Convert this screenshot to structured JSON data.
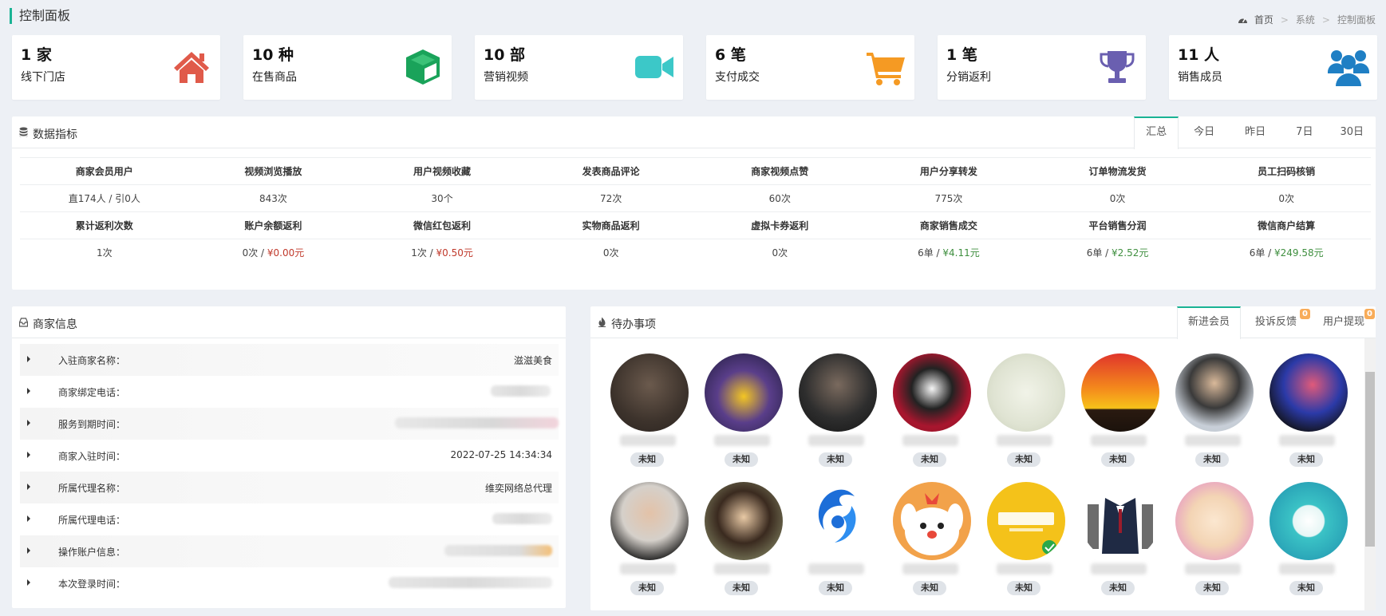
{
  "header": {
    "title": "控制面板",
    "breadcrumb": [
      "首页",
      "系统",
      "控制面板"
    ]
  },
  "stats": [
    {
      "value": "1 家",
      "label": "线下门店",
      "icon": "house-icon",
      "color": "#e05a4a"
    },
    {
      "value": "10 种",
      "label": "在售商品",
      "icon": "cube-icon",
      "color": "#1aa35a"
    },
    {
      "value": "10 部",
      "label": "营销视频",
      "icon": "video-camera-icon",
      "color": "#3cc8c8"
    },
    {
      "value": "6 笔",
      "label": "支付成交",
      "icon": "shopping-cart-icon",
      "color": "#f59a23"
    },
    {
      "value": "1 笔",
      "label": "分销返利",
      "icon": "trophy-icon",
      "color": "#6a5fb0"
    },
    {
      "value": "11 人",
      "label": "销售成员",
      "icon": "users-icon",
      "color": "#1f7fc4"
    }
  ],
  "metrics": {
    "title": "数据指标",
    "tabs": [
      "汇总",
      "今日",
      "昨日",
      "7日",
      "30日"
    ],
    "active_tab": "汇总",
    "row1_headers": [
      "商家会员用户",
      "视频浏览播放",
      "用户视频收藏",
      "发表商品评论",
      "商家视频点赞",
      "用户分享转发",
      "订单物流发货",
      "员工扫码核销"
    ],
    "row1_values": [
      "直174人 / 引0人",
      "843次",
      "30个",
      "72次",
      "60次",
      "775次",
      "0次",
      "0次"
    ],
    "row2_headers": [
      "累计返利次数",
      "账户余额返利",
      "微信红包返利",
      "实物商品返利",
      "虚拟卡券返利",
      "商家销售成交",
      "平台销售分润",
      "微信商户结算"
    ],
    "row2_values": [
      {
        "a": "1次",
        "b": ""
      },
      {
        "a": "0次 / ",
        "b": "¥0.00元",
        "cls": "red"
      },
      {
        "a": "1次 / ",
        "b": "¥0.50元",
        "cls": "red"
      },
      {
        "a": "0次",
        "b": ""
      },
      {
        "a": "0次",
        "b": ""
      },
      {
        "a": "6单 / ",
        "b": "¥4.11元",
        "cls": "green"
      },
      {
        "a": "6单 / ",
        "b": "¥2.52元",
        "cls": "green"
      },
      {
        "a": "6单 / ",
        "b": "¥249.58元",
        "cls": "green"
      }
    ]
  },
  "merchant": {
    "title": "商家信息",
    "rows": [
      {
        "label": "入驻商家名称：",
        "value": "滋滋美食"
      },
      {
        "label": "商家绑定电话：",
        "value": ""
      },
      {
        "label": "服务到期时间：",
        "value": ""
      },
      {
        "label": "商家入驻时间：",
        "value": "2022-07-25 14:34:34"
      },
      {
        "label": "所属代理名称：",
        "value": "维奕网络总代理"
      },
      {
        "label": "所属代理电话：",
        "value": ""
      },
      {
        "label": "操作账户信息：",
        "value": ""
      },
      {
        "label": "本次登录时间：",
        "value": ""
      }
    ]
  },
  "todo": {
    "title": "待办事项",
    "tabs": [
      {
        "label": "新进会员",
        "badge": ""
      },
      {
        "label": "投诉反馈",
        "badge": "0"
      },
      {
        "label": "用户提现",
        "badge": "0"
      }
    ],
    "tag": "未知"
  }
}
